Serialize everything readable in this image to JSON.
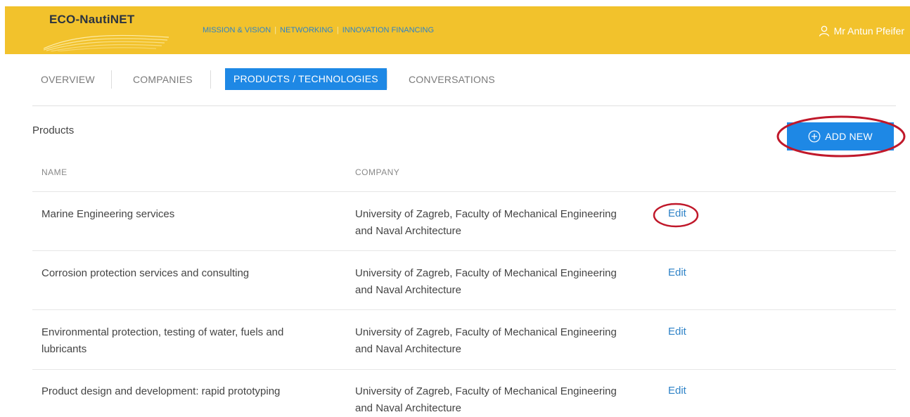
{
  "header": {
    "logo": "ECO-NautiNET",
    "nav": [
      {
        "label": "MISSION & VISION"
      },
      {
        "label": "NETWORKING"
      },
      {
        "label": "INNOVATION FINANCING"
      }
    ],
    "user_name": "Mr Antun Pfeifer"
  },
  "tabs": [
    {
      "label": "OVERVIEW"
    },
    {
      "label": "COMPANIES"
    },
    {
      "label": "PRODUCTS / TECHNOLOGIES"
    },
    {
      "label": "CONVERSATIONS"
    }
  ],
  "products": {
    "title": "Products",
    "add_label": "ADD NEW",
    "columns": [
      "NAME",
      "COMPANY"
    ],
    "rows": [
      {
        "name_lines": [
          "Marine Engineering services"
        ],
        "company_lines": [
          "University of Zagreb, Faculty of Mechanical Engineering",
          "and Naval Architecture"
        ],
        "action": "Edit"
      },
      {
        "name_lines": [
          "Corrosion protection services and consulting"
        ],
        "company_lines": [
          "University of Zagreb, Faculty of Mechanical Engineering",
          "and Naval Architecture"
        ],
        "action": "Edit"
      },
      {
        "name_lines": [
          "Environmental protection, testing of water, fuels and",
          "lubricants"
        ],
        "company_lines": [
          "University of Zagreb, Faculty of Mechanical Engineering",
          "and Naval Architecture"
        ],
        "action": "Edit"
      },
      {
        "name_lines": [
          "Product design and development: rapid prototyping"
        ],
        "company_lines": [
          "University of Zagreb, Faculty of Mechanical Engineering",
          "and Naval Architecture"
        ],
        "action": "Edit"
      }
    ]
  },
  "colors": {
    "header_bg": "#f2c22c",
    "accent": "#1e88e5",
    "link": "#2f83c7",
    "annotation": "#c0182a"
  }
}
